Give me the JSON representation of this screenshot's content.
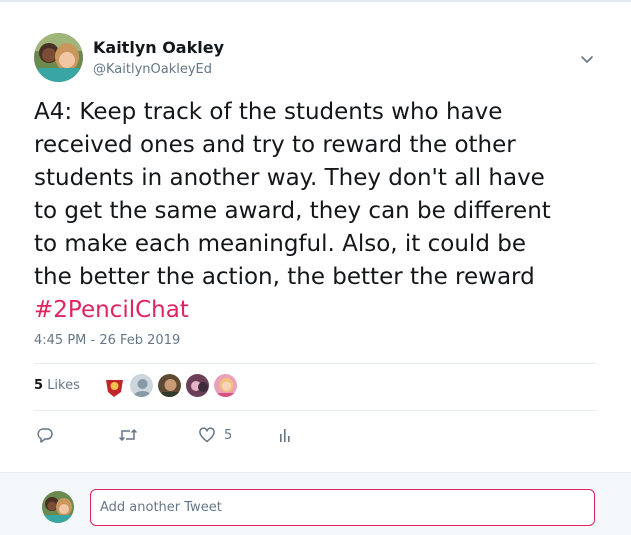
{
  "tweet": {
    "author_name": "Kaitlyn Oakley",
    "author_handle": "@KaitlynOakleyEd",
    "text_lines": [
      "A4: Keep track of the students who have",
      "received ones and try to reward the other",
      "students in another way. They don't all have",
      "to get the same award, they can be different",
      "to make each meaningful. Also, it could be",
      "the better the action, the better the reward"
    ],
    "hashtag": "#2PencilChat",
    "timestamp": "4:45 PM - 26 Feb 2019"
  },
  "stats": {
    "likes_count": "5",
    "likes_label": "Likes"
  },
  "actions": {
    "reply_icon": "reply-icon",
    "retweet_icon": "retweet-icon",
    "like_icon": "heart-icon",
    "like_count": "5",
    "analytics_icon": "analytics-icon"
  },
  "reply": {
    "placeholder": "Add another Tweet"
  },
  "colors": {
    "hashtag": "#e0245e",
    "secondary_text": "#657786",
    "reply_border": "#e0245e"
  }
}
